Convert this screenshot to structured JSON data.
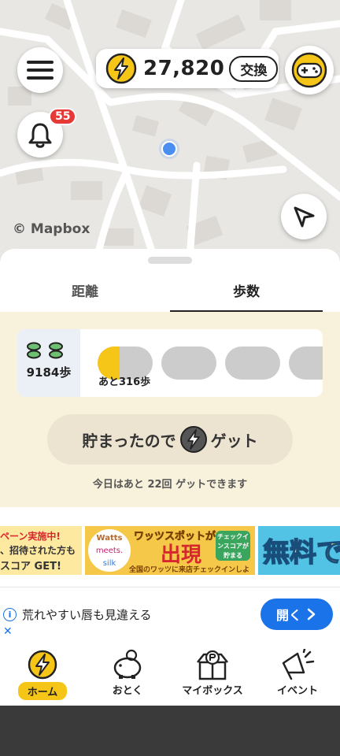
{
  "map": {
    "attribution": "© Mapbox",
    "notification_count": "55"
  },
  "wallet": {
    "coins": "27,820",
    "exchange_label": "交換"
  },
  "tabs": [
    {
      "label": "距離",
      "active": false
    },
    {
      "label": "歩数",
      "active": true
    }
  ],
  "steps": {
    "count": "9184歩",
    "remaining": "あと316歩",
    "progress_first_slot": 0.4
  },
  "collect": {
    "label_before": "貯まったので",
    "label_after": "ゲット",
    "note": "今日はあと 22回 ゲットできます"
  },
  "banners": {
    "left": {
      "line1": "ペーン実施中!",
      "line2": "、招待された方も",
      "line3": "スコア GET!"
    },
    "center": {
      "title": "ワッツスポットが",
      "headline": "出現",
      "brand1": "Watts",
      "brand2": "meets.",
      "brand3": "silk",
      "footer": "全国のワッツに来店チェックインしよう!",
      "badge": "チェックインスコアが貯まる"
    },
    "right": {
      "text": "無料で"
    }
  },
  "ad": {
    "text": "荒れやすい唇も見違える",
    "button": "開く",
    "info_icon": "i",
    "close_icon": "✕"
  },
  "nav": [
    {
      "label": "ホーム",
      "icon": "bolt-coin-icon",
      "active": true
    },
    {
      "label": "おとく",
      "icon": "piggy-bank-icon",
      "active": false
    },
    {
      "label": "マイボックス",
      "icon": "gift-box-icon",
      "active": false
    },
    {
      "label": "イベント",
      "icon": "megaphone-icon",
      "active": false
    }
  ],
  "colors": {
    "accent": "#f5c518",
    "sheet_bg": "#f8f1dc",
    "collect_bg": "#ece3d0",
    "ad_button": "#1a73e8",
    "badge": "#e53935",
    "location_dot": "#4a8ff0"
  }
}
